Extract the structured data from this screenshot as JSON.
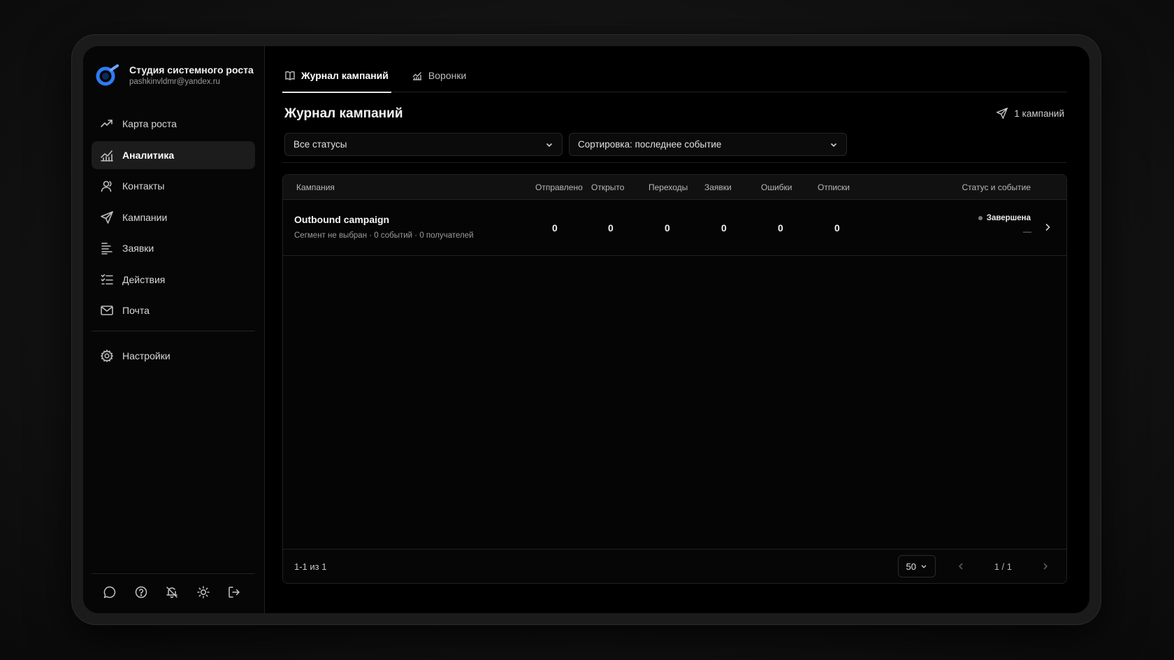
{
  "brand": {
    "name": "Студия системного роста",
    "email": "pashkinvldmr@yandex.ru",
    "logo_icon": "logo-ring-icon",
    "accent": "#2f7bf5"
  },
  "nav": {
    "items": [
      {
        "label": "Карта роста",
        "icon": "growth-icon"
      },
      {
        "label": "Аналитика",
        "icon": "analytics-icon",
        "active": true
      },
      {
        "label": "Контакты",
        "icon": "user-icon"
      },
      {
        "label": "Кампании",
        "icon": "send-icon"
      },
      {
        "label": "Заявки",
        "icon": "list-icon"
      },
      {
        "label": "Действия",
        "icon": "checklist-icon"
      },
      {
        "label": "Почта",
        "icon": "mail-icon"
      }
    ],
    "settings": {
      "label": "Настройки",
      "icon": "gear-icon"
    }
  },
  "bottom_icons": [
    "chat-icon",
    "help-icon",
    "bell-off-icon",
    "sun-icon",
    "logout-icon"
  ],
  "tabs": [
    {
      "label": "Журнал кампаний",
      "icon": "book-icon",
      "active": true
    },
    {
      "label": "Воронки",
      "icon": "chart-icon"
    }
  ],
  "page": {
    "title": "Журнал кампаний",
    "count": "1 кампаний"
  },
  "filters": {
    "status": "Все статусы",
    "sort": "Сортировка: последнее событие"
  },
  "table": {
    "columns": [
      "Кампания",
      "Отправлено",
      "Открыто",
      "Переходы",
      "Заявки",
      "Ошибки",
      "Отписки",
      "Статус и событие"
    ],
    "rows": [
      {
        "name": "Outbound campaign",
        "meta": "Сегмент не выбран · 0 событий · 0 получателей",
        "sent": "0",
        "opened": "0",
        "clicks": "0",
        "leads": "0",
        "errors": "0",
        "unsubs": "0",
        "status": "Завершена",
        "event": "—"
      }
    ]
  },
  "footer": {
    "range": "1-1 из 1",
    "page_size": "50",
    "page_info": "1 / 1"
  }
}
